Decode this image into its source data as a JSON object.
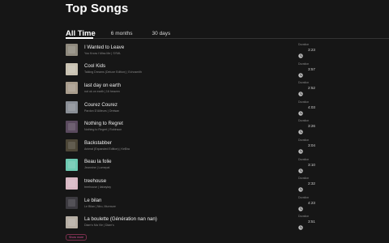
{
  "header": {
    "title": "Top Songs"
  },
  "tabs": [
    {
      "label": "All Time",
      "active": true
    },
    {
      "label": "6 months",
      "active": false
    },
    {
      "label": "30 days",
      "active": false
    }
  ],
  "songs": [
    {
      "title": "I Wanted to Leave",
      "subtitle": "You Know I Miss Me | SYML",
      "duration_label": "Duration",
      "duration": "3:23",
      "cover_color": "#8f8a7e"
    },
    {
      "title": "Cool Kids",
      "subtitle": "Talking Dreams (Deluxe Edition) | Echosmith",
      "duration_label": "Duration",
      "duration": "3:57",
      "cover_color": "#c9c2b2"
    },
    {
      "title": "last day on earth",
      "subtitle": "not ok on earth | 16 heaven",
      "duration_label": "Duration",
      "duration": "2:52",
      "cover_color": "#a99d8d"
    },
    {
      "title": "Courez Courez",
      "subtitle": "Pardon D'Ailleurs | Orelsan",
      "duration_label": "Duration",
      "duration": "4:03",
      "cover_color": "#8a8f96"
    },
    {
      "title": "Nothing to Regret",
      "subtitle": "Nothing to Regret | Robinson",
      "duration_label": "Duration",
      "duration": "3:26",
      "cover_color": "#5a4a5e"
    },
    {
      "title": "Backstabber",
      "subtitle": "Animal (Expanded Edition) | Ke$ha",
      "duration_label": "Duration",
      "duration": "3:04",
      "cover_color": "#4c4637"
    },
    {
      "title": "Beau la folie",
      "subtitle": "Jeannine | Lomepal",
      "duration_label": "Duration",
      "duration": "3:10",
      "cover_color": "#6dc9b1"
    },
    {
      "title": "treehouse",
      "subtitle": "treehouse | ilabaytay",
      "duration_label": "Duration",
      "duration": "2:32",
      "cover_color": "#d8b8c4"
    },
    {
      "title": "Le bilan",
      "subtitle": "Le Bilan | Niro, Murmure",
      "duration_label": "Duration",
      "duration": "4:23",
      "cover_color": "#3c3a40"
    },
    {
      "title": "La boulette (Génération nan nan)",
      "subtitle": "Diam's Ma Vie | Diam's",
      "duration_label": "Duration",
      "duration": "3:51",
      "cover_color": "#b6aea4"
    }
  ],
  "show_more": {
    "label": "Show more"
  },
  "icons": {
    "duration": "clock-icon"
  },
  "colors": {
    "accent": "#e0509a",
    "background": "#161616"
  }
}
